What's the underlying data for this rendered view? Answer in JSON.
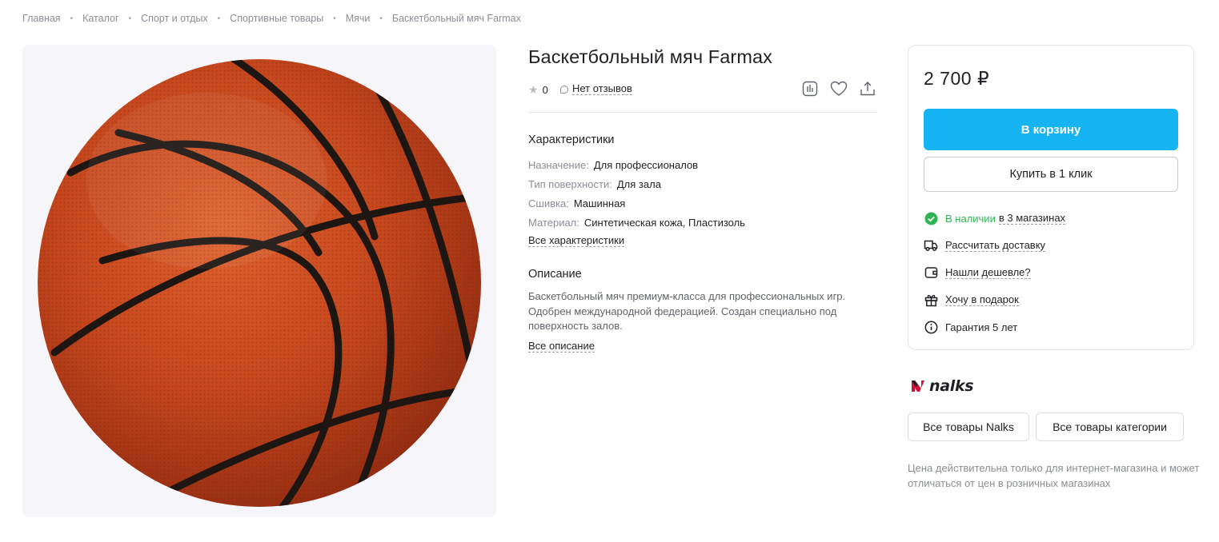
{
  "breadcrumbs": [
    "Главная",
    "Каталог",
    "Спорт и отдых",
    "Спортивные товары",
    "Мячи",
    "Баскетбольный мяч Farmax"
  ],
  "product": {
    "title": "Баскетбольный мяч Farmax",
    "rating": "0",
    "reviews_label": "Нет отзывов"
  },
  "specs": {
    "title": "Характеристики",
    "items": [
      {
        "key": "Назначение:",
        "value": "Для профессионалов"
      },
      {
        "key": "Тип поверхности:",
        "value": "Для зала"
      },
      {
        "key": "Сшивка:",
        "value": "Машинная"
      },
      {
        "key": "Материал:",
        "value": "Синтетическая кожа, Пластизоль"
      }
    ],
    "all_link": "Все характеристики"
  },
  "description": {
    "title": "Описание",
    "text": "Баскетбольный мяч премиум-класса для профессиональных игр. Одобрен международной федерацией. Создан специально под поверхность залов.",
    "all_link": "Все описание"
  },
  "buy": {
    "price": "2 700 ₽",
    "cart_button": "В корзину",
    "one_click_button": "Купить в 1 клик",
    "availability_status": "В наличии",
    "availability_stores": "в 3 магазинах",
    "delivery": "Рассчитать доставку",
    "cheaper": "Нашли дешевле?",
    "gift": "Хочу в подарок",
    "warranty": "Гарантия 5 лет"
  },
  "brand": {
    "name": "nalks",
    "all_brand_button": "Все товары Nalks",
    "all_category_button": "Все товары категории"
  },
  "note": "Цена действительна только для интернет-магазина и может отличаться от цен в розничных магазинах",
  "colors": {
    "accent": "#17b4f3",
    "in_stock": "#2fb553",
    "brand_red": "#d0103a",
    "ball": "#c4461d"
  },
  "icons": {
    "rating": "star-icon",
    "reviews": "comment-icon",
    "actions": [
      "compare-icon",
      "heart-icon",
      "share-icon"
    ],
    "options": [
      "check-circle-icon",
      "truck-icon",
      "wallet-icon",
      "gift-icon",
      "info-icon"
    ]
  }
}
